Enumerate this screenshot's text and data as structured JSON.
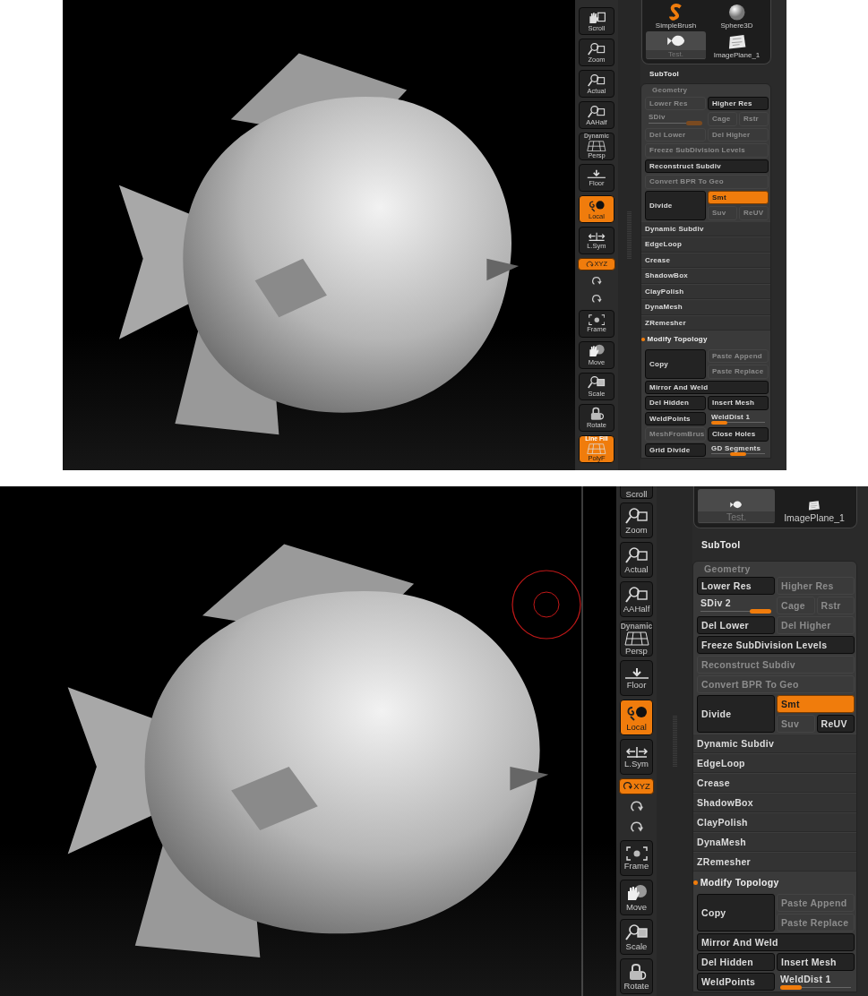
{
  "screenshots": [
    {
      "viewport": {
        "cursor": false
      },
      "toolbar": [
        {
          "kind": "button",
          "label": "Scroll",
          "on": false
        },
        {
          "kind": "button",
          "label": "Zoom",
          "on": false
        },
        {
          "kind": "button",
          "label": "Actual",
          "on": false
        },
        {
          "kind": "button",
          "label": "AAHalf",
          "on": false
        },
        {
          "kind": "button",
          "label": "Persp",
          "caption": "Dynamic",
          "on": false
        },
        {
          "kind": "button",
          "label": "Floor",
          "on": false
        },
        {
          "kind": "button",
          "label": "Local",
          "on": true
        },
        {
          "kind": "button",
          "label": "L.Sym",
          "on": false
        },
        {
          "kind": "small",
          "label": "XYZ",
          "on": true
        },
        {
          "kind": "icon",
          "on": false
        },
        {
          "kind": "icon",
          "on": false
        },
        {
          "kind": "button",
          "label": "Frame",
          "on": false
        },
        {
          "kind": "button",
          "label": "Move",
          "on": false
        },
        {
          "kind": "button",
          "label": "Scale",
          "on": false
        },
        {
          "kind": "button",
          "label": "Rotate",
          "on": false
        },
        {
          "kind": "button",
          "label": "PolyF",
          "caption": "Line Fill",
          "on": true
        }
      ],
      "tools": [
        {
          "label": "SimpleBrush",
          "selected": false
        },
        {
          "label": "Sphere3D",
          "selected": false
        },
        {
          "label": "Test.",
          "selected": true
        },
        {
          "label": "ImagePlane_1",
          "selected": false
        }
      ],
      "subtool_label": "SubTool",
      "geometry": {
        "title": "Geometry",
        "rows": [
          {
            "kind": "split",
            "left": {
              "kind": "button",
              "label": "Lower Res",
              "disabled": true
            },
            "right": [
              [
                {
                  "kind": "button",
                  "label": "Higher Res",
                  "disabled": false
                }
              ]
            ]
          },
          {
            "kind": "split",
            "left": {
              "kind": "slider",
              "label": "SDiv",
              "level": 1,
              "disabled": true
            },
            "right": [
              [
                {
                  "kind": "button",
                  "label": "Cage",
                  "disabled": true
                },
                {
                  "kind": "button",
                  "label": "Rstr",
                  "disabled": true
                }
              ]
            ]
          },
          {
            "kind": "split",
            "left": {
              "kind": "button",
              "label": "Del Lower",
              "disabled": true
            },
            "right": [
              [
                {
                  "kind": "button",
                  "label": "Del Higher",
                  "disabled": true
                }
              ]
            ]
          },
          {
            "kind": "wide",
            "cell": {
              "kind": "button",
              "label": "Freeze SubDivision Levels",
              "disabled": true
            }
          },
          {
            "kind": "wide",
            "cell": {
              "kind": "button",
              "label": "Reconstruct Subdiv",
              "disabled": false
            }
          },
          {
            "kind": "wide",
            "cell": {
              "kind": "button",
              "label": "Convert BPR To Geo",
              "disabled": true
            }
          },
          {
            "kind": "split",
            "left": {
              "kind": "button",
              "label": "Divide",
              "disabled": false
            },
            "right": [
              [
                {
                  "kind": "toggle",
                  "label": "Smt",
                  "on": true
                }
              ],
              [
                {
                  "kind": "button",
                  "label": "Suv",
                  "disabled": true
                },
                {
                  "kind": "button",
                  "label": "ReUV",
                  "disabled": true
                }
              ]
            ]
          },
          {
            "kind": "item",
            "label": "Dynamic Subdiv"
          },
          {
            "kind": "item",
            "label": "EdgeLoop"
          },
          {
            "kind": "item",
            "label": "Crease"
          },
          {
            "kind": "item",
            "label": "ShadowBox"
          },
          {
            "kind": "item",
            "label": "ClayPolish"
          },
          {
            "kind": "item",
            "label": "DynaMesh"
          },
          {
            "kind": "item",
            "label": "ZRemesher"
          },
          {
            "kind": "subheader",
            "label": "Modify Topology"
          },
          {
            "kind": "split",
            "left": {
              "kind": "button",
              "label": "Copy",
              "disabled": false
            },
            "right": [
              [
                {
                  "kind": "button",
                  "label": "Paste Append",
                  "disabled": true
                }
              ],
              [
                {
                  "kind": "button",
                  "label": "Paste Replace",
                  "disabled": true
                }
              ]
            ]
          },
          {
            "kind": "wide",
            "cell": {
              "kind": "button",
              "label": "Mirror And Weld",
              "disabled": false
            }
          },
          {
            "kind": "split",
            "left": {
              "kind": "button",
              "label": "Del Hidden",
              "disabled": false
            },
            "right": [
              [
                {
                  "kind": "button",
                  "label": "Insert Mesh",
                  "disabled": false
                }
              ]
            ]
          },
          {
            "kind": "split",
            "left": {
              "kind": "button",
              "label": "WeldPoints",
              "disabled": false
            },
            "right": [
              [
                {
                  "kind": "slider",
                  "label": "WeldDist 1",
                  "level": 0,
                  "disabled": false
                }
              ]
            ]
          },
          {
            "kind": "split",
            "left": {
              "kind": "button",
              "label": "MeshFromBrus",
              "disabled": true
            },
            "right": [
              [
                {
                  "kind": "button",
                  "label": "Close Holes",
                  "disabled": false
                }
              ]
            ]
          },
          {
            "kind": "split",
            "left": {
              "kind": "button",
              "label": "Grid Divide",
              "disabled": false
            },
            "right": [
              [
                {
                  "kind": "slider",
                  "label": "GD Segments",
                  "level": 0.5,
                  "disabled": false
                }
              ]
            ]
          }
        ]
      }
    },
    {
      "viewport": {
        "cursor": true
      },
      "toolbar": [
        {
          "kind": "stub",
          "label": "Scroll",
          "on": false
        },
        {
          "kind": "button",
          "label": "Zoom",
          "on": false
        },
        {
          "kind": "button",
          "label": "Actual",
          "on": false
        },
        {
          "kind": "button",
          "label": "AAHalf",
          "on": false
        },
        {
          "kind": "button",
          "label": "Persp",
          "caption": "Dynamic",
          "on": false
        },
        {
          "kind": "button",
          "label": "Floor",
          "on": false
        },
        {
          "kind": "button",
          "label": "Local",
          "on": true
        },
        {
          "kind": "button",
          "label": "L.Sym",
          "on": false
        },
        {
          "kind": "small",
          "label": "XYZ",
          "on": true
        },
        {
          "kind": "icon",
          "on": false
        },
        {
          "kind": "icon",
          "on": false
        },
        {
          "kind": "button",
          "label": "Frame",
          "on": false
        },
        {
          "kind": "button",
          "label": "Move",
          "on": false
        },
        {
          "kind": "button",
          "label": "Scale",
          "on": false
        },
        {
          "kind": "button",
          "label": "Rotate",
          "on": false
        }
      ],
      "tools": [
        {
          "label": "Test.",
          "selected": true
        },
        {
          "label": "ImagePlane_1",
          "selected": false
        }
      ],
      "subtool_label": "SubTool",
      "geometry": {
        "title": "Geometry",
        "rows": [
          {
            "kind": "split",
            "left": {
              "kind": "button",
              "label": "Lower Res",
              "disabled": false
            },
            "right": [
              [
                {
                  "kind": "button",
                  "label": "Higher Res",
                  "disabled": true
                }
              ]
            ]
          },
          {
            "kind": "split",
            "left": {
              "kind": "slider",
              "label": "SDiv 2",
              "level": 1,
              "disabled": false
            },
            "right": [
              [
                {
                  "kind": "button",
                  "label": "Cage",
                  "disabled": true
                },
                {
                  "kind": "button",
                  "label": "Rstr",
                  "disabled": true
                }
              ]
            ]
          },
          {
            "kind": "split",
            "left": {
              "kind": "button",
              "label": "Del Lower",
              "disabled": false
            },
            "right": [
              [
                {
                  "kind": "button",
                  "label": "Del Higher",
                  "disabled": true
                }
              ]
            ]
          },
          {
            "kind": "wide",
            "cell": {
              "kind": "button",
              "label": "Freeze SubDivision Levels",
              "disabled": false
            }
          },
          {
            "kind": "wide",
            "cell": {
              "kind": "button",
              "label": "Reconstruct Subdiv",
              "disabled": true
            }
          },
          {
            "kind": "wide",
            "cell": {
              "kind": "button",
              "label": "Convert BPR To Geo",
              "disabled": true
            }
          },
          {
            "kind": "split",
            "left": {
              "kind": "button",
              "label": "Divide",
              "disabled": false
            },
            "right": [
              [
                {
                  "kind": "toggle",
                  "label": "Smt",
                  "on": true
                }
              ],
              [
                {
                  "kind": "button",
                  "label": "Suv",
                  "disabled": true
                },
                {
                  "kind": "button",
                  "label": "ReUV",
                  "disabled": false
                }
              ]
            ]
          },
          {
            "kind": "item",
            "label": "Dynamic Subdiv"
          },
          {
            "kind": "item",
            "label": "EdgeLoop"
          },
          {
            "kind": "item",
            "label": "Crease"
          },
          {
            "kind": "item",
            "label": "ShadowBox"
          },
          {
            "kind": "item",
            "label": "ClayPolish"
          },
          {
            "kind": "item",
            "label": "DynaMesh"
          },
          {
            "kind": "item",
            "label": "ZRemesher"
          },
          {
            "kind": "subheader",
            "label": "Modify Topology"
          },
          {
            "kind": "split",
            "left": {
              "kind": "button",
              "label": "Copy",
              "disabled": false
            },
            "right": [
              [
                {
                  "kind": "button",
                  "label": "Paste Append",
                  "disabled": true
                }
              ],
              [
                {
                  "kind": "button",
                  "label": "Paste Replace",
                  "disabled": true
                }
              ]
            ]
          },
          {
            "kind": "wide",
            "cell": {
              "kind": "button",
              "label": "Mirror And Weld",
              "disabled": false
            }
          },
          {
            "kind": "split",
            "left": {
              "kind": "button",
              "label": "Del Hidden",
              "disabled": false
            },
            "right": [
              [
                {
                  "kind": "button",
                  "label": "Insert Mesh",
                  "disabled": false
                }
              ]
            ]
          },
          {
            "kind": "split",
            "left": {
              "kind": "button",
              "label": "WeldPoints",
              "disabled": false
            },
            "right": [
              [
                {
                  "kind": "slider",
                  "label": "WeldDist 1",
                  "level": 0,
                  "disabled": false
                }
              ]
            ]
          }
        ]
      }
    }
  ]
}
